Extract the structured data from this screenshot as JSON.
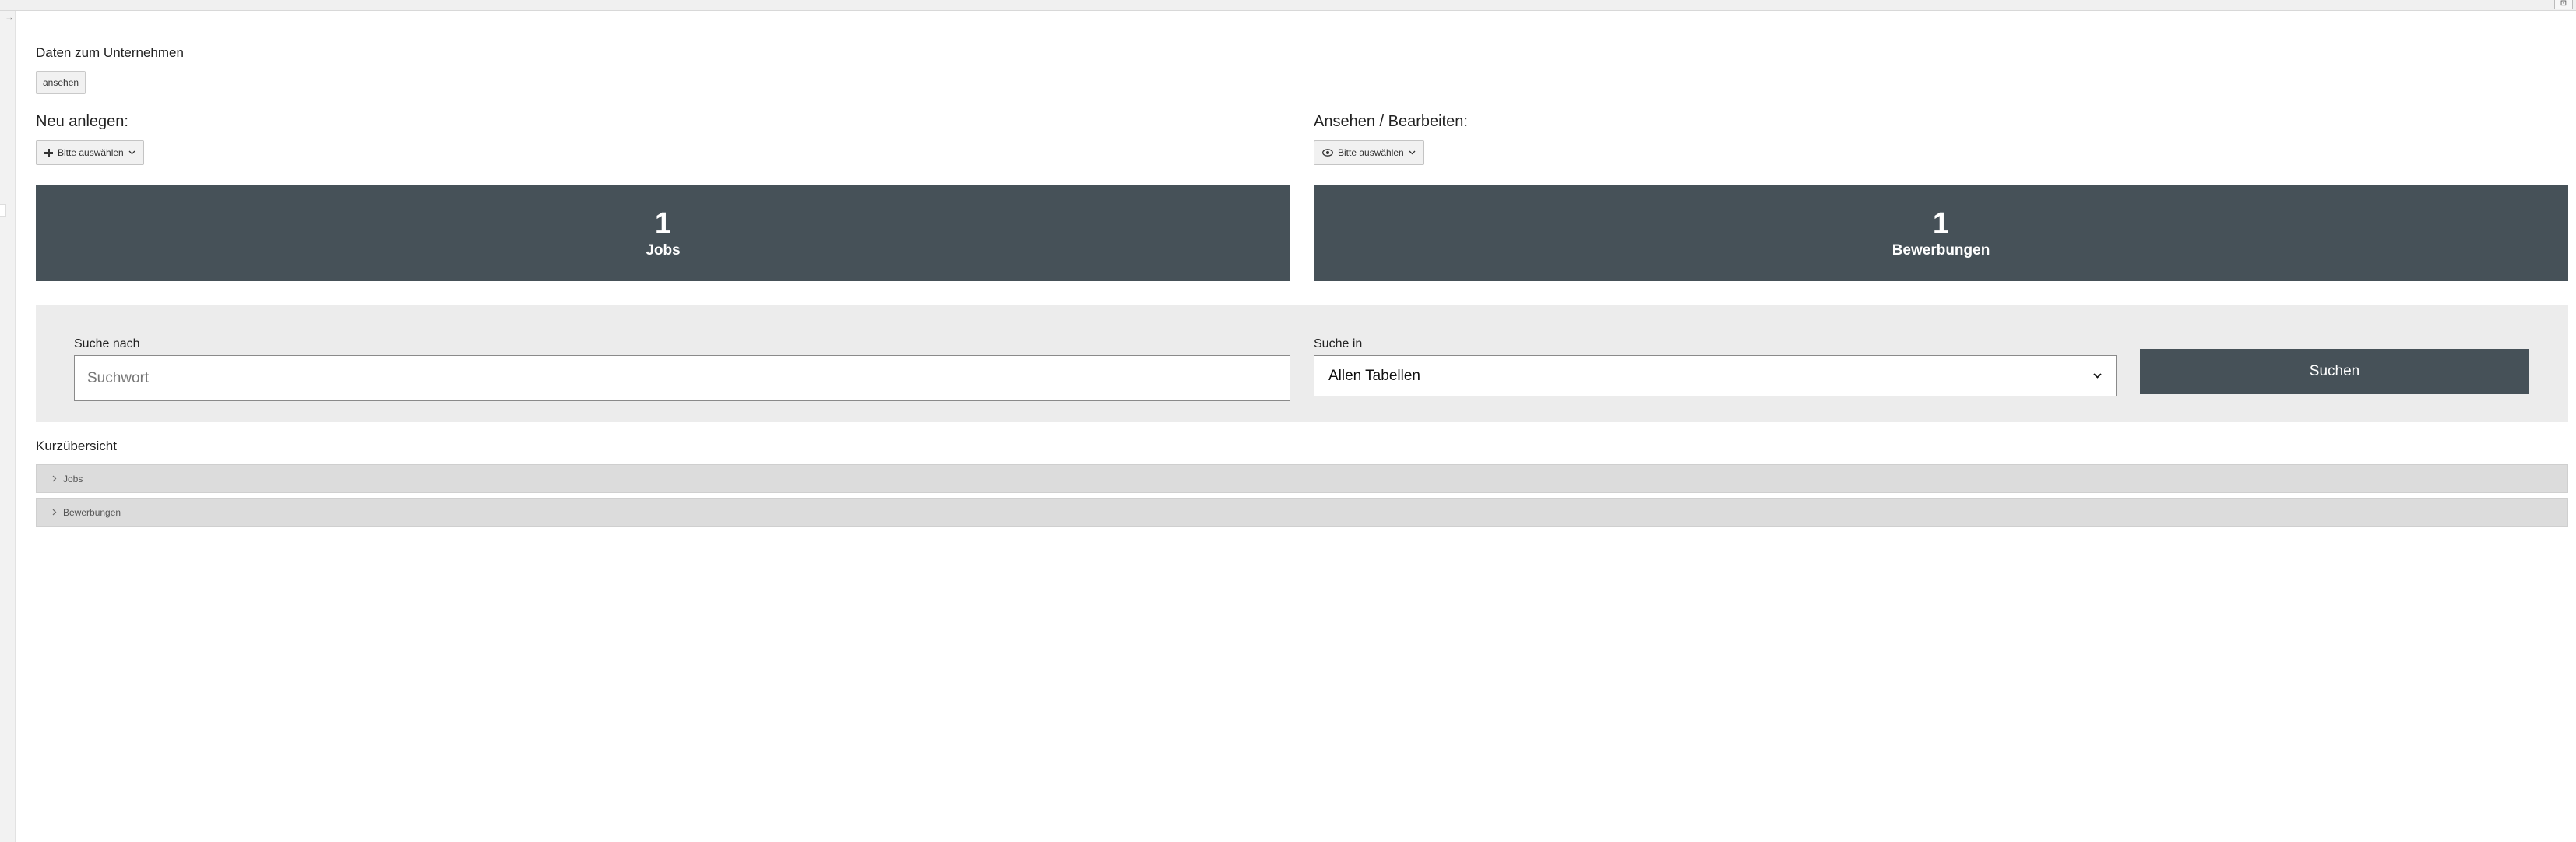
{
  "window": {
    "corner_button": "⊡"
  },
  "sidebar": {
    "toggle": "→"
  },
  "company": {
    "title": "Daten zum Unternehmen",
    "view_button": "ansehen"
  },
  "create": {
    "heading": "Neu anlegen:",
    "dropdown_label": "Bitte auswählen",
    "icon": "plus-icon"
  },
  "view_edit": {
    "heading": "Ansehen / Bearbeiten:",
    "dropdown_label": "Bitte auswählen",
    "icon": "eye-icon"
  },
  "stats": [
    {
      "count": "1",
      "label": "Jobs"
    },
    {
      "count": "1",
      "label": "Bewerbungen"
    }
  ],
  "search": {
    "query_label": "Suche nach",
    "query_placeholder": "Suchwort",
    "scope_label": "Suche in",
    "scope_selected": "Allen Tabellen",
    "submit_label": "Suchen"
  },
  "overview": {
    "title": "Kurzübersicht",
    "items": [
      {
        "label": "Jobs"
      },
      {
        "label": "Bewerbungen"
      }
    ]
  },
  "colors": {
    "tile_bg": "#465158",
    "panel_bg": "#ececec",
    "accordion_bg": "#dcdcdc"
  }
}
